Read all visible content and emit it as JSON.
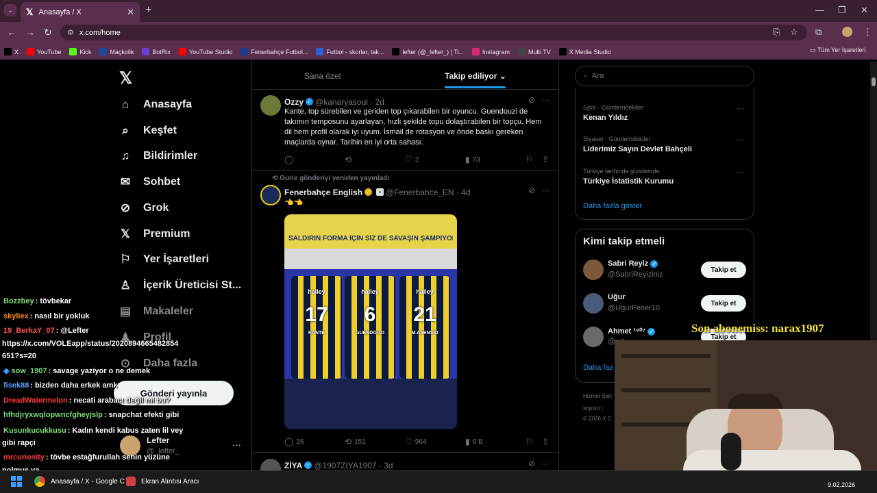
{
  "browser": {
    "tab_title": "Anasayfa / X",
    "url": "x.com/home",
    "bookmarks": [
      {
        "label": "X",
        "color": "#000000"
      },
      {
        "label": "YouTube",
        "color": "#ff0000"
      },
      {
        "label": "Kick",
        "color": "#53fc18"
      },
      {
        "label": "Maçkolik",
        "color": "#1b4a9c"
      },
      {
        "label": "BotRix",
        "color": "#6b3fd1"
      },
      {
        "label": "YouTube Studio",
        "color": "#ff0000"
      },
      {
        "label": "Fenerbahçe Futbol...",
        "color": "#1a3c8f"
      },
      {
        "label": "Futbol - skorlar, tak...",
        "color": "#2a5fd8"
      },
      {
        "label": "lefter (@_lefter_) | Ti...",
        "color": "#000000"
      },
      {
        "label": "Instagram",
        "color": "#d62976"
      },
      {
        "label": "Multi TV",
        "color": "#444444"
      },
      {
        "label": "X Media Studio",
        "color": "#000000"
      }
    ],
    "all_bookmarks": "Tüm Yer İşaretleri"
  },
  "sidebar": {
    "items": [
      {
        "label": "Anasayfa",
        "icon": "home-icon"
      },
      {
        "label": "Keşfet",
        "icon": "search-icon"
      },
      {
        "label": "Bildirimler",
        "icon": "bell-icon"
      },
      {
        "label": "Sohbet",
        "icon": "mail-icon"
      },
      {
        "label": "Grok",
        "icon": "grok-icon"
      },
      {
        "label": "Premium",
        "icon": "x-icon"
      },
      {
        "label": "Yer İşaretleri",
        "icon": "bookmark-icon"
      },
      {
        "label": "İçerik Üreticisi St...",
        "icon": "creator-icon"
      },
      {
        "label": "Makaleler",
        "icon": "article-icon"
      },
      {
        "label": "Profil",
        "icon": "profile-icon"
      },
      {
        "label": "Daha fazla",
        "icon": "more-icon"
      }
    ],
    "post_button": "Gönderi yayınla",
    "user_name": "Lefter",
    "user_handle": "@_lefter_"
  },
  "feed": {
    "tabs": [
      "Sana özel",
      "Takip ediliyor"
    ],
    "tweets": [
      {
        "name": "Ozzy",
        "handle": "@kanaryasoul · 2d",
        "text": "Kante, top sürebilen ve geriden top çıkarabilen bir oyuncu. Guendouzi de takımın temposunu ayarlayan, hızlı şekilde topu dolaştırabilen bir topçu. Hem dil hem profil olarak iyi uyum. İsmail de rotasyon ve önde baskı gereken maçlarda oynar. Tarihin en iyi orta sahası.",
        "likes": "2",
        "views": "73"
      },
      {
        "repost_note": "Gurix gönderiyi yeniden yayınladı",
        "name": "Fenerbahçe English",
        "handle": "@Fenerbahce_EN · 4d",
        "text": "👈👈",
        "media_banner": "SALDIRIN FORMA İÇİN SİZ DE SAVAŞIN  ŞAMPİYONLUK",
        "jerseys": [
          {
            "sponsor": "halley",
            "number": "17",
            "player": "KANTÉ"
          },
          {
            "sponsor": "halley",
            "number": "6",
            "player": "GUENDOUZI"
          },
          {
            "sponsor": "halley",
            "number": "21",
            "player": "M.ASENSIO"
          }
        ],
        "replies": "26",
        "reposts": "151",
        "likes": "964",
        "views": "6 B"
      },
      {
        "name": "ZİYA",
        "handle": "@1907ZİYA1907 · 3d"
      }
    ]
  },
  "right": {
    "search_placeholder": "Ara",
    "trends": [
      {
        "meta": "Spor · Gündemdekiler",
        "name": "Kenan Yıldız"
      },
      {
        "meta": "Siyaset · Gündemdekiler",
        "name": "Liderimiz Sayın Devlet Bahçeli"
      },
      {
        "meta": "Türkiye tarihinde gündemde",
        "name": "Türkiye İstatistik Kurumu"
      }
    ],
    "show_more": "Daha fazla göster",
    "who_to_follow_title": "Kimi takip etmeli",
    "who_to_follow": [
      {
        "name": "Sabri Reyiz",
        "handle": "@SabriReyiziniz",
        "button": "Takip et"
      },
      {
        "name": "Uğur",
        "handle": "@UgurFener10",
        "button": "Takip et"
      },
      {
        "name": "Ahmet ¹⁹⁰⁷",
        "handle": "@ad...",
        "button": "Takip et"
      }
    ],
    "show_more_2": "Daha faz",
    "footer": [
      "Hizmet Şart",
      "Imprint  |",
      "© 2026 X C"
    ]
  },
  "chat": [
    {
      "user": "Bozzbey",
      "color": "#7ee07e",
      "msg": ": tövbekar"
    },
    {
      "user": "skyliex",
      "color": "#ff8c1a",
      "msg": ": nasıl bir yokluk"
    },
    {
      "user": "19_BerkaY_07",
      "color": "#ff5555",
      "msg": ": @Lefter"
    },
    {
      "user": "",
      "color": "#ffffff",
      "msg": "https://x.com/VOLEapp/status/2020894665482854"
    },
    {
      "user": "",
      "color": "#ffffff",
      "msg": "651?s=20"
    },
    {
      "user": "sow_1907",
      "color": "#7ee07e",
      "msg": ": savage yaziyor o ne demek"
    },
    {
      "user": "fisek88",
      "color": "#5aa0ff",
      "msg": ": bizden daha erkek amk"
    },
    {
      "user": "DreadWatermelon",
      "color": "#ff3b3b",
      "msg": ": necati arabacı değil mi bu?"
    },
    {
      "user": "hfhdjryxwqlopwncfgheyjslp",
      "color": "#7ee07e",
      "msg": ": snapchat efekti gibi"
    },
    {
      "user": "Kusunkucukkusu",
      "color": "#7ee07e",
      "msg": ": Kadın kendi kabus zaten lil vey"
    },
    {
      "user": "",
      "color": "#ffffff",
      "msg": "gibi rapçi"
    },
    {
      "user": "mrcuriosity",
      "color": "#ff3b3b",
      "msg": ": tövbe estağfurullah senin yüzüne"
    },
    {
      "user": "",
      "color": "#ffffff",
      "msg": "nolmuş ya"
    }
  ],
  "overlay": {
    "last_sub": "Son abonemiss: narax1907"
  },
  "taskbar": {
    "items": [
      "Anasayfa / X - Google C",
      "Ekran Alıntısı Aracı"
    ],
    "date": "9.02.2026"
  }
}
